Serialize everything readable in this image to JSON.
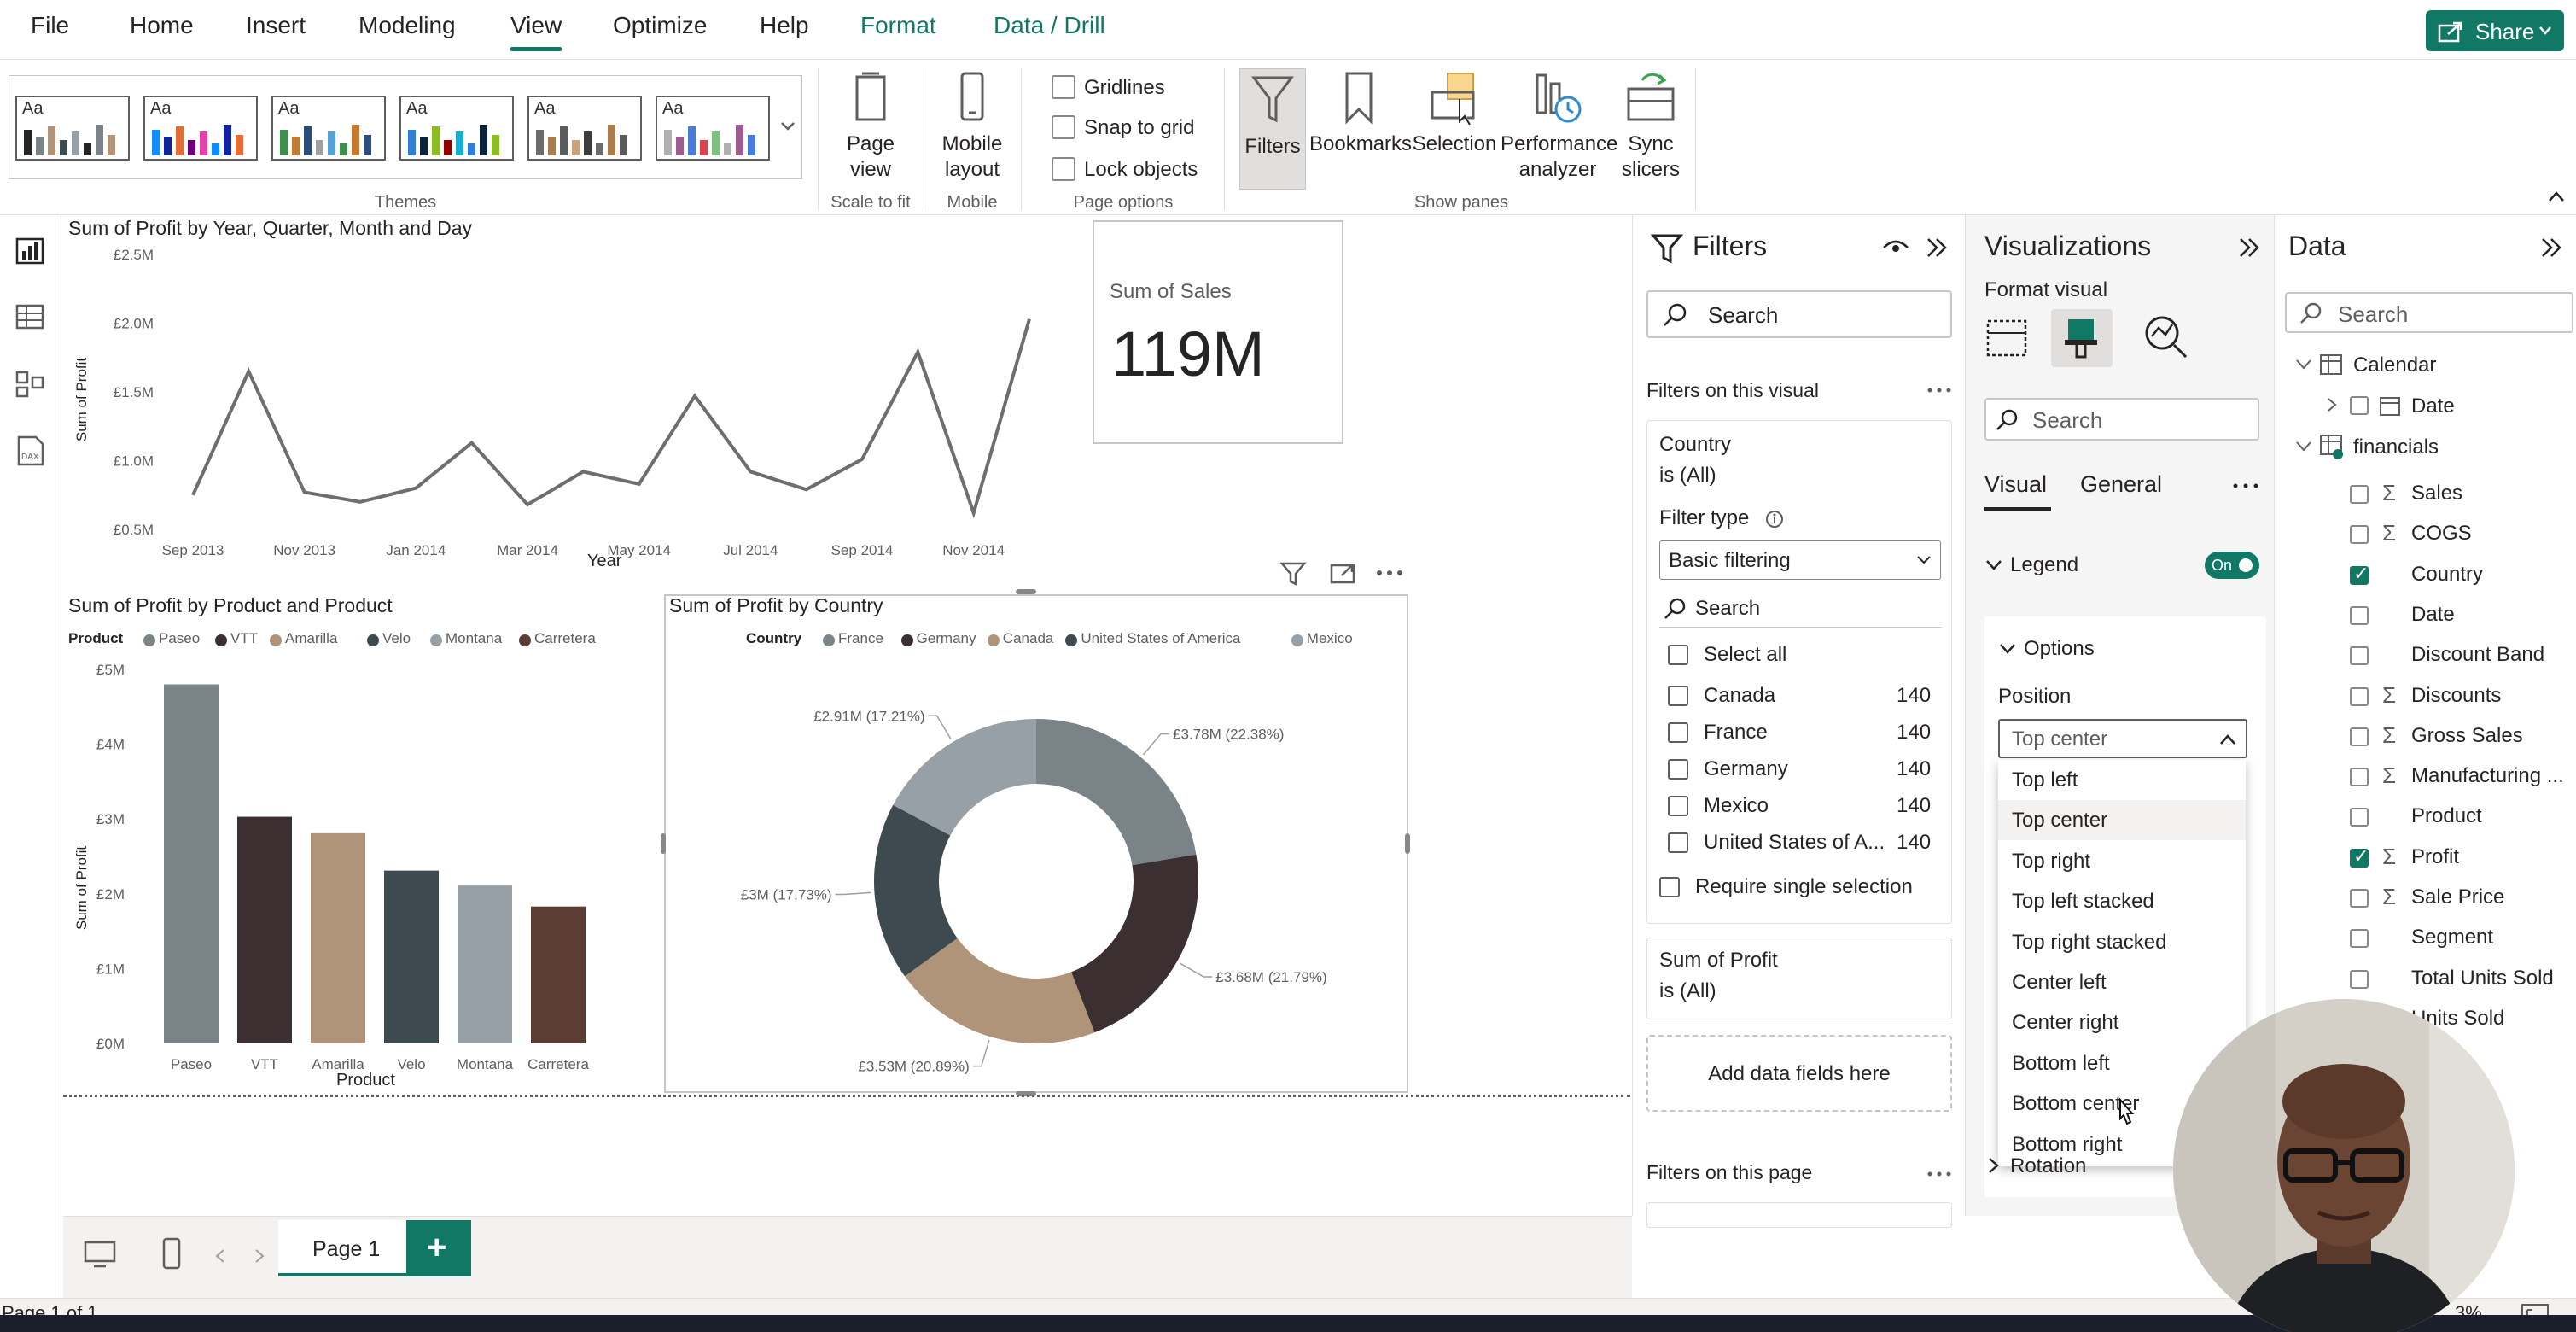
{
  "ribbon": {
    "tabs": [
      "File",
      "Home",
      "Insert",
      "Modeling",
      "View",
      "Optimize",
      "Help",
      "Format",
      "Data / Drill"
    ],
    "active_tab": "View",
    "share_label": "Share",
    "themes_label": "Themes",
    "page_view": {
      "label1": "Page",
      "label2": "view",
      "group": "Scale to fit"
    },
    "mobile": {
      "label1": "Mobile",
      "label2": "layout",
      "group": "Mobile"
    },
    "page_options": {
      "gridlines": "Gridlines",
      "snap": "Snap to grid",
      "lock": "Lock objects",
      "group": "Page options"
    },
    "panes": {
      "filters": "Filters",
      "bookmarks": "Bookmarks",
      "selection": "Selection",
      "perf1": "Performance",
      "perf2": "analyzer",
      "sync1": "Sync",
      "sync2": "slicers",
      "group": "Show panes"
    },
    "theme_aa": "Aa"
  },
  "line_chart": {
    "title": "Sum of Profit by Year, Quarter, Month and Day",
    "ylabel": "Sum of Profit",
    "xlabel": "Year",
    "yticks": [
      "£2.5M",
      "£2.0M",
      "£1.5M",
      "£1.0M",
      "£0.5M"
    ],
    "xticks": [
      "Sep 2013",
      "Nov 2013",
      "Jan 2014",
      "Mar 2014",
      "May 2014",
      "Jul 2014",
      "Sep 2014",
      "Nov 2014"
    ]
  },
  "card": {
    "label": "Sum of Sales",
    "value": "119M"
  },
  "bar_chart": {
    "title": "Sum of Profit by Product and Product",
    "legend_title": "Product",
    "ylabel": "Sum of Profit",
    "xlabel": "Product",
    "yticks": [
      "£5M",
      "£4M",
      "£3M",
      "£2M",
      "£1M",
      "£0M"
    ]
  },
  "donut_chart": {
    "title": "Sum of Profit by Country",
    "legend_title": "Country"
  },
  "chart_data": [
    {
      "type": "line",
      "title": "Sum of Profit by Year, Quarter, Month and Day",
      "xlabel": "Year",
      "ylabel": "Sum of Profit",
      "x": [
        "Sep 2013",
        "Oct 2013",
        "Nov 2013",
        "Dec 2013",
        "Jan 2014",
        "Feb 2014",
        "Mar 2014",
        "Apr 2014",
        "May 2014",
        "Jun 2014",
        "Jul 2014",
        "Aug 2014",
        "Sep 2014",
        "Oct 2014",
        "Nov 2014",
        "Dec 2014"
      ],
      "values": [
        0.75,
        1.65,
        0.77,
        0.7,
        0.8,
        1.13,
        0.68,
        0.92,
        0.83,
        1.47,
        0.92,
        0.79,
        1.01,
        1.79,
        0.62,
        2.03
      ],
      "ylim": [
        0.5,
        2.5
      ],
      "unit": "£M"
    },
    {
      "type": "bar",
      "title": "Sum of Profit by Product and Product",
      "xlabel": "Product",
      "ylabel": "Sum of Profit",
      "categories": [
        "Paseo",
        "VTT",
        "Amarilla",
        "Velo",
        "Montana",
        "Carretera"
      ],
      "values": [
        4.8,
        3.03,
        2.81,
        2.31,
        2.11,
        1.83
      ],
      "colors": [
        "#7a8387",
        "#3c2f31",
        "#b09479",
        "#3d4a4f",
        "#96a0a6",
        "#5c3d34"
      ],
      "ylim": [
        0,
        5
      ],
      "unit": "£M"
    },
    {
      "type": "pie",
      "title": "Sum of Profit by Country",
      "categories": [
        "France",
        "Germany",
        "Canada",
        "United States of America",
        "Mexico"
      ],
      "values": [
        3.78,
        3.68,
        3.53,
        3.0,
        2.91
      ],
      "labels": [
        "£3.78M (22.38%)",
        "£3.68M (21.79%)",
        "£3.53M (20.89%)",
        "£3M (17.73%)",
        "£2.91M (17.21%)"
      ],
      "colors": [
        "#7a8387",
        "#3c2f31",
        "#b09479",
        "#3d4a4f",
        "#96a0a6"
      ]
    }
  ],
  "filters": {
    "title": "Filters",
    "search_placeholder": "Search",
    "on_visual": "Filters on this visual",
    "country_card": {
      "field": "Country",
      "state": "is (All)"
    },
    "filter_type_label": "Filter type",
    "filter_type_value": "Basic filtering",
    "inner_search": "Search",
    "select_all": "Select all",
    "items": [
      {
        "label": "Canada",
        "count": "140"
      },
      {
        "label": "France",
        "count": "140"
      },
      {
        "label": "Germany",
        "count": "140"
      },
      {
        "label": "Mexico",
        "count": "140"
      },
      {
        "label": "United States of A...",
        "count": "140"
      }
    ],
    "require_single": "Require single selection",
    "profit_card": {
      "field": "Sum of Profit",
      "state": "is (All)"
    },
    "add_fields": "Add data fields here",
    "on_page": "Filters on this page"
  },
  "viz": {
    "title": "Visualizations",
    "format_visual": "Format visual",
    "search_placeholder": "Search",
    "tab_visual": "Visual",
    "tab_general": "General",
    "legend_label": "Legend",
    "toggle_label": "On",
    "options_label": "Options",
    "position_label": "Position",
    "position_value": "Top center",
    "dropdown_options": [
      "Top left",
      "Top center",
      "Top right",
      "Top left stacked",
      "Top right stacked",
      "Center left",
      "Center right",
      "Bottom left",
      "Bottom center",
      "Bottom right"
    ],
    "rotation_label": "Rotation"
  },
  "data": {
    "title": "Data",
    "search_placeholder": "Search",
    "calendar": "Calendar",
    "calendar_date": "Date",
    "financials": "financials",
    "fields": [
      {
        "label": "Sales",
        "sigma": true,
        "checked": false
      },
      {
        "label": "COGS",
        "sigma": true,
        "checked": false
      },
      {
        "label": "Country",
        "sigma": false,
        "checked": true
      },
      {
        "label": "Date",
        "sigma": false,
        "checked": false
      },
      {
        "label": "Discount Band",
        "sigma": false,
        "checked": false
      },
      {
        "label": "Discounts",
        "sigma": true,
        "checked": false
      },
      {
        "label": "Gross Sales",
        "sigma": true,
        "checked": false
      },
      {
        "label": "Manufacturing ...",
        "sigma": true,
        "checked": false
      },
      {
        "label": "Product",
        "sigma": false,
        "checked": false
      },
      {
        "label": "Profit",
        "sigma": true,
        "checked": true
      },
      {
        "label": "Sale Price",
        "sigma": true,
        "checked": false
      },
      {
        "label": "Segment",
        "sigma": false,
        "checked": false
      },
      {
        "label": "Total Units Sold",
        "sigma": false,
        "checked": false
      },
      {
        "label": "Units Sold",
        "sigma": true,
        "checked": false
      }
    ]
  },
  "pages": {
    "tab": "Page 1",
    "add": "+"
  },
  "status": {
    "page_count": "Page 1 of 1",
    "zoom_partial": "3%"
  },
  "colors": {
    "accent": "#117865",
    "donut_hole": "#ffffff"
  }
}
